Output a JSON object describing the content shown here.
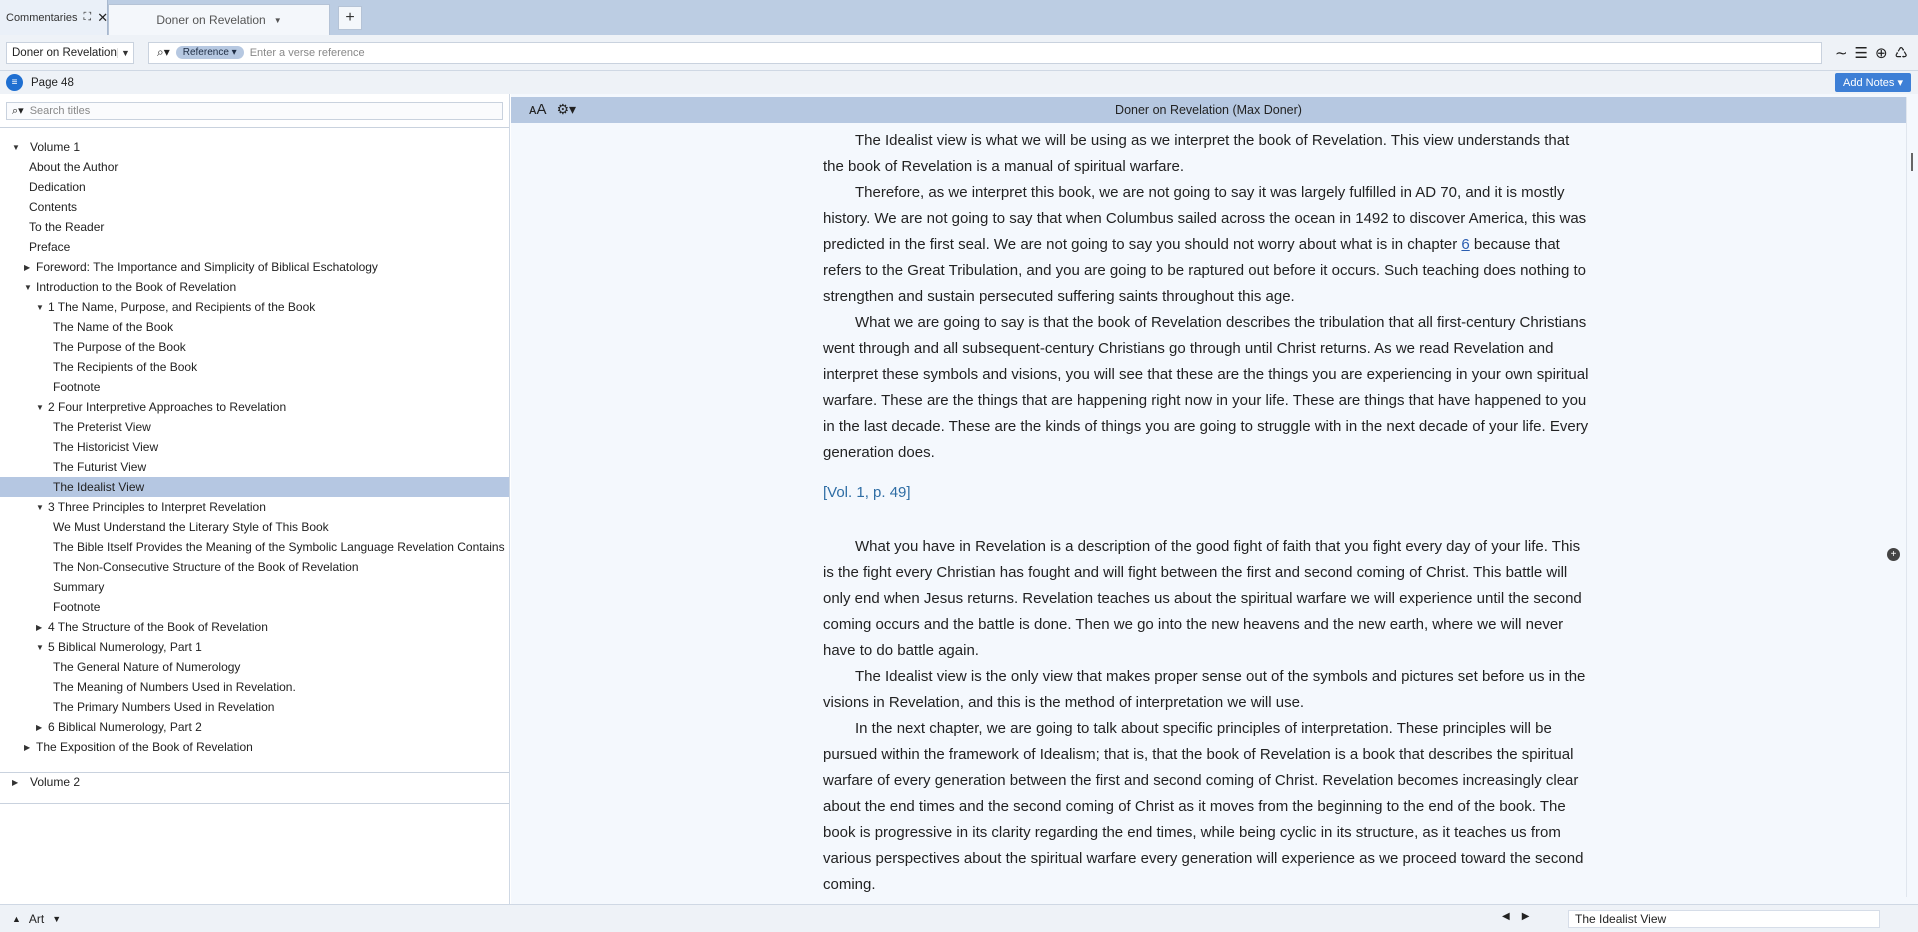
{
  "tabs": {
    "commentaries_label": "Commentaries",
    "doc_tab_label": "Doner on Revelation",
    "add_tab_label": "+"
  },
  "toolbar": {
    "resource_value": "Doner on Revelation",
    "reference_pill": "Reference",
    "reference_placeholder": "Enter a verse reference",
    "icons": [
      "wave-icon",
      "list-icon",
      "plus-circle-icon",
      "recycle-icon"
    ]
  },
  "pagebar": {
    "page_label": "Page 48",
    "add_notes_label": "Add Notes"
  },
  "left": {
    "search_placeholder": "Search titles",
    "volume1": "Volume 1",
    "toc": [
      "About the Author",
      "Dedication",
      "Contents",
      "To the Reader",
      "Preface",
      "Foreword: The Importance and Simplicity of Biblical Eschatology",
      "Introduction to the Book of Revelation",
      "1 The Name, Purpose, and Recipients of the Book",
      "The Name of the Book",
      "The Purpose of the Book",
      "The Recipients of the Book",
      "Footnote",
      "2 Four Interpretive Approaches to Revelation",
      "The Preterist View",
      "The Historicist View",
      "The Futurist View",
      "The Idealist View",
      "3 Three Principles to Interpret Revelation",
      "We Must Understand the Literary Style of This Book",
      "The Bible Itself Provides the Meaning of the Symbolic Language Revelation Contains",
      "The Non-Consecutive Structure of the Book of Revelation",
      "Summary",
      "Footnote",
      "4 The Structure of the Book of Revelation",
      "5 Biblical Numerology, Part 1",
      "The General Nature of Numerology",
      "The Meaning of Numbers Used in Revelation.",
      "The Primary Numbers Used in Revelation",
      "6 Biblical Numerology, Part 2",
      "The Exposition of the Book of Revelation"
    ],
    "volume2": "Volume 2"
  },
  "reader": {
    "title": "Doner on Revelation (Max Doner)",
    "p1": "The Idealist view is what we will be using as we interpret the book of Revelation. This view understands that the book of Revelation is a manual of spiritual warfare.",
    "p2a": "Therefore, as we interpret this book, we are not going to say it was largely fulfilled in AD 70, and it is mostly history. We are not going to say that when Columbus sailed across the ocean in 1492 to discover America, this was predicted in the first seal. We are not going to say you should not worry about what is in chapter ",
    "p2link": "6",
    "p2b": " because that refers to the Great Tribulation, and you are going to be raptured out before it occurs. Such teaching does nothing to strengthen and sustain persecuted suffering saints throughout this age.",
    "p3": "What we are going to say is that the book of Revelation describes the tribulation that all first-century Christians went through and all subsequent-century Christians go through until Christ returns. As we read Revelation and interpret these symbols and visions, you will see that these are the things you are experiencing in your own spiritual warfare. These are the things that are happening right now in your life. These are things that have happened to you in the last decade. These are the kinds of things you are going to struggle with in the next decade of your life. Every generation does.",
    "pageref": "[Vol. 1, p. 49]",
    "p4": "What you have in Revelation is a description of the good fight of faith that you fight every day of your life. This is the fight every Christian has fought and will fight between the first and second coming of Christ. This battle will only end when Jesus returns. Revelation teaches us about the spiritual warfare we will experience until the second coming occurs and the battle is done. Then we go into the new heavens and the new earth, where we will never have to do battle again.",
    "p5": "The Idealist view is the only view that makes proper sense out of the symbols and pictures set before us in the visions in Revelation, and this is the method of interpretation we will use.",
    "p6": "In the next chapter, we are going to talk about specific principles of interpretation. These principles will be pursued within the framework of Idealism; that is, that the book of Revelation is a book that describes the spiritual warfare of every generation between the first and second coming of Christ. Revelation becomes increasingly clear about the end times and the second coming of Christ as it moves from the beginning to the end of the book. The book is progressive in its clarity regarding the end times, while being cyclic in its structure, as it teaches us from various perspectives about the spiritual warfare every generation will experience as we proceed toward the second coming."
  },
  "bottom": {
    "panel_label": "Art",
    "location": "The Idealist View"
  }
}
